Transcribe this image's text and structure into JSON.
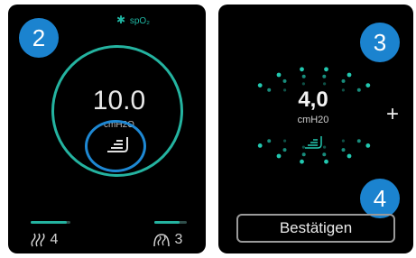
{
  "screen1": {
    "badge": "2",
    "status": {
      "bluetooth_icon": "bluetooth-icon",
      "label": "spO₂"
    },
    "value": "10.0",
    "unit": "cmH2O",
    "humidifier_icon": "humidifier-icon",
    "left_footer": {
      "icon": "humidity-icon",
      "value": "4"
    },
    "right_footer": {
      "icon": "tube-heat-icon",
      "value": "3"
    },
    "colors": {
      "accent": "#24b3a0",
      "focus": "#1e88d3",
      "badge": "#1b83cf"
    }
  },
  "screen2": {
    "badge_top": "3",
    "badge_bottom": "4",
    "value": "4,0",
    "unit": "cmH20",
    "plus_label": "+",
    "confirm_label": "Bestätigen",
    "colors": {
      "dots": "#22c8b0"
    }
  }
}
